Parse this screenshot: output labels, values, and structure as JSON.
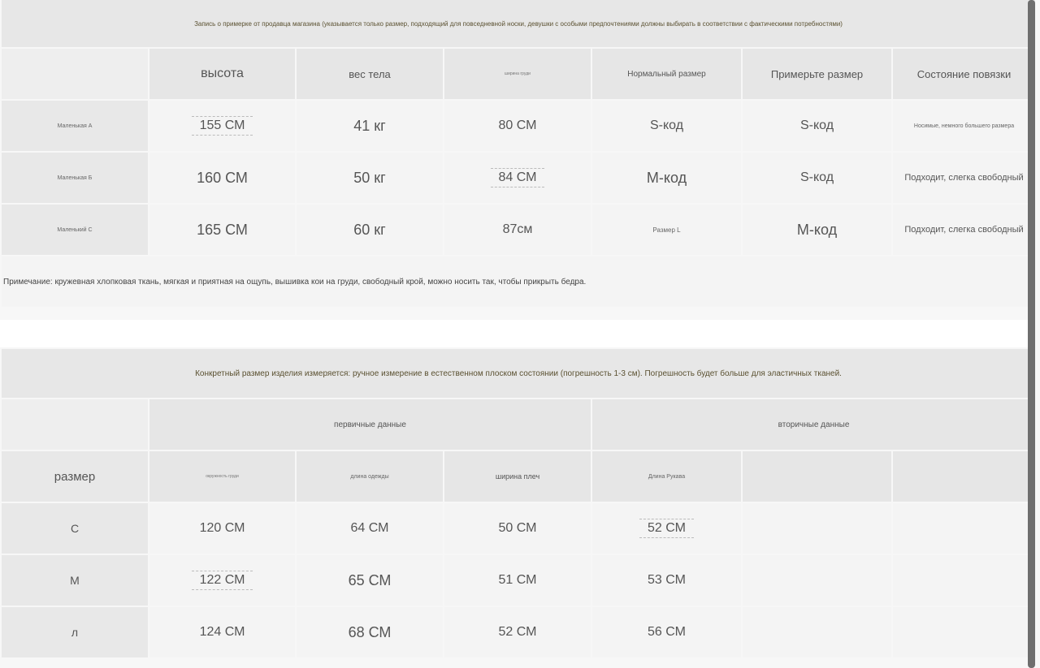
{
  "fit_table": {
    "banner": "Запись о примерке от продавца магазина (указывается только размер, подходящий для повседневной носки, девушки с особыми предпочтениями должны выбирать в соответствии с фактическими потребностями)",
    "headers": {
      "height": "высота",
      "weight": "вес тела",
      "bust": "ширина груди",
      "normal_size": "Нормальный размер",
      "try_size": "Примерьте размер",
      "fit_state": "Состояние повязки"
    },
    "rows": [
      {
        "label": "Маленькая А",
        "height": "155 СМ",
        "weight": "41 кг",
        "bust": "80 СМ",
        "normal_size": "S-код",
        "try_size": "S-код",
        "fit_state": "Носимые, немного большего размера"
      },
      {
        "label": "Маленькая Б",
        "height": "160 СМ",
        "weight": "50 кг",
        "bust": "84 СМ",
        "normal_size": "М-код",
        "try_size": "S-код",
        "fit_state": "Подходит, слегка свободный"
      },
      {
        "label": "Маленький С",
        "height": "165 СМ",
        "weight": "60 кг",
        "bust": "87см",
        "normal_size": "Размер L",
        "try_size": "М-код",
        "fit_state": "Подходит, слегка свободный"
      }
    ],
    "note": "Примечание: кружевная хлопковая ткань, мягкая и приятная на ощупь, вышивка кои на груди, свободный крой, можно носить так, чтобы прикрыть бедра."
  },
  "size_table": {
    "banner": "Конкретный размер изделия измеряется: ручное измерение в естественном плоском состоянии (погрешность 1-3 см). Погрешность будет больше для эластичных тканей.",
    "group_primary": "первичные данные",
    "group_secondary": "вторичные данные",
    "size_label": "размер",
    "headers": {
      "bust": "окружность груди",
      "length": "длина одежды",
      "shoulder": "ширина плеч",
      "sleeve": "Длина Рукава"
    },
    "rows": [
      {
        "size": "С",
        "bust": "120 СМ",
        "length": "64 СМ",
        "shoulder": "50 СМ",
        "sleeve": "52 СМ"
      },
      {
        "size": "М",
        "bust": "122 СМ",
        "length": "65 СМ",
        "shoulder": "51 СМ",
        "sleeve": "53 СМ"
      },
      {
        "size": "л",
        "bust": "124 СМ",
        "length": "68 СМ",
        "shoulder": "52 СМ",
        "sleeve": "56 СМ"
      }
    ]
  }
}
